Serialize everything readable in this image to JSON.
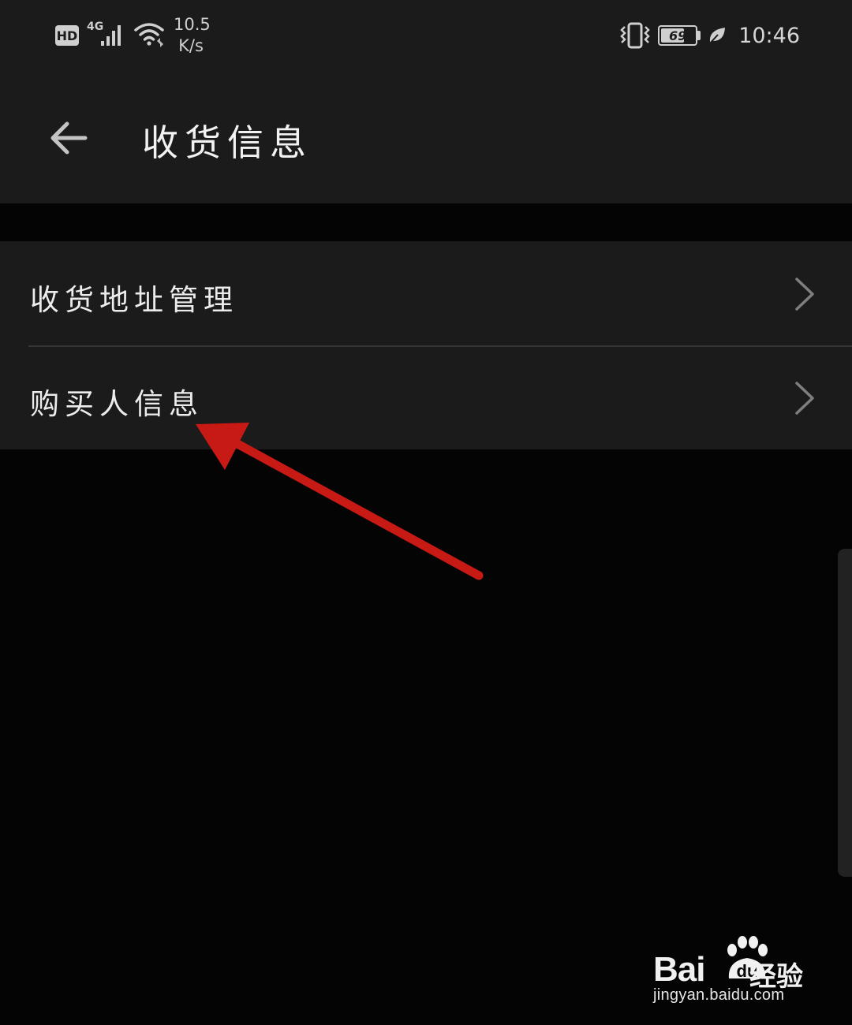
{
  "status_bar": {
    "hd_label": "HD",
    "network_label": "4G",
    "net_speed_value": "10.5",
    "net_speed_unit": "K/s",
    "battery_level": "69",
    "battery_fraction": 0.69,
    "time": "10:46"
  },
  "header": {
    "title": "收货信息",
    "back_icon": "arrow-left-icon"
  },
  "menu": {
    "items": [
      {
        "label": "收货地址管理",
        "icon": "chevron-right-icon"
      },
      {
        "label": "购买人信息",
        "icon": "chevron-right-icon"
      }
    ]
  },
  "annotation": {
    "color": "#c81a14",
    "target": "购买人信息"
  },
  "watermark": {
    "brand": "Bai",
    "brand_du": "du",
    "brand_cn": "经验",
    "url": "jingyan.baidu.com"
  },
  "colors": {
    "background": "#040404",
    "surface": "#1b1b1b",
    "divider": "#353535",
    "text": "#ececec"
  }
}
